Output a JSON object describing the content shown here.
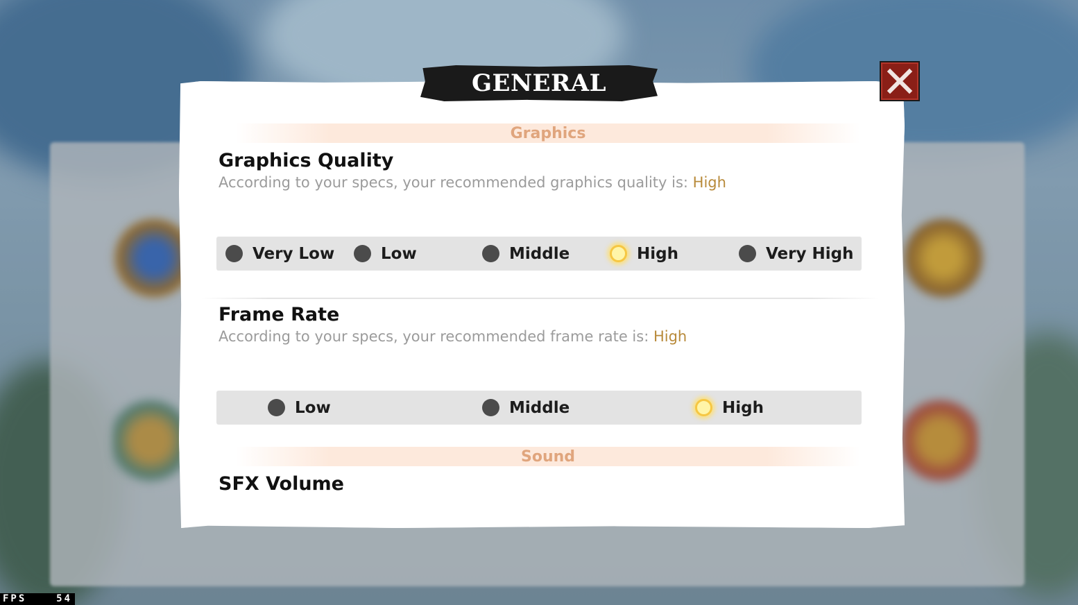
{
  "hud": {
    "fps_label": "FPS",
    "fps_value": "54"
  },
  "dialog": {
    "title": "GENERAL",
    "close_icon": "close-x-icon",
    "sections": {
      "graphics": {
        "header": "Graphics"
      },
      "sound": {
        "header": "Sound"
      }
    },
    "graphics_quality": {
      "title": "Graphics Quality",
      "desc_prefix": "According to your specs, your recommended graphics quality is: ",
      "recommended": "High",
      "options": [
        "Very Low",
        "Low",
        "Middle",
        "High",
        "Very High"
      ],
      "selected": "High"
    },
    "frame_rate": {
      "title": "Frame Rate",
      "desc_prefix": "According to your specs, your recommended frame rate is: ",
      "recommended": "High",
      "options": [
        "Low",
        "Middle",
        "High"
      ],
      "selected": "High"
    },
    "sfx_volume": {
      "title": "SFX Volume"
    }
  },
  "colors": {
    "section_header_text": "#e0a57d",
    "recommended_text": "#b88a3a",
    "radio_selected": "#f6c743",
    "close_button": "#8a1f17"
  }
}
